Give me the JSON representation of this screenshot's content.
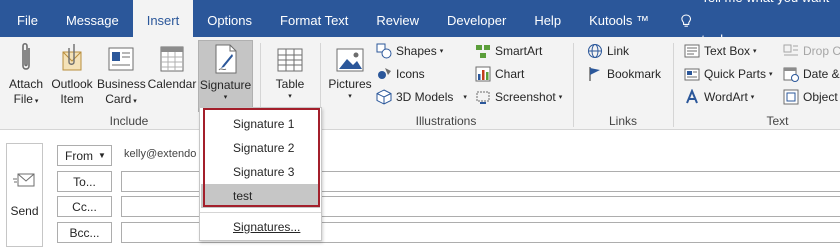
{
  "tabs": [
    {
      "label": "File",
      "active": false
    },
    {
      "label": "Message",
      "active": false
    },
    {
      "label": "Insert",
      "active": true
    },
    {
      "label": "Options",
      "active": false
    },
    {
      "label": "Format Text",
      "active": false
    },
    {
      "label": "Review",
      "active": false
    },
    {
      "label": "Developer",
      "active": false
    },
    {
      "label": "Help",
      "active": false
    },
    {
      "label": "Kutools ™",
      "active": false
    }
  ],
  "tell_me": "Tell me what you want to do",
  "ribbon": {
    "include": {
      "label": "Include",
      "attach_file": [
        "Attach",
        "File"
      ],
      "outlook_item": [
        "Outlook",
        "Item"
      ],
      "business_card": [
        "Business",
        "Card"
      ],
      "calendar": "Calendar",
      "signature": "Signature"
    },
    "tables": {
      "table": "Table"
    },
    "illustrations": {
      "label": "Illustrations",
      "pictures": "Pictures",
      "shapes": "Shapes",
      "icons": "Icons",
      "models_3d": "3D Models",
      "smartart": "SmartArt",
      "chart": "Chart",
      "screenshot": "Screenshot"
    },
    "links": {
      "label": "Links",
      "link": "Link",
      "bookmark": "Bookmark"
    },
    "text": {
      "label": "Text",
      "text_box": "Text Box",
      "quick_parts": "Quick Parts",
      "wordart": "WordArt",
      "drop_cap": "Drop Ca",
      "date_time": "Date &",
      "object": "Object"
    }
  },
  "compose": {
    "send": "Send",
    "from": "From",
    "from_value": "kelly@extendo",
    "to": "To...",
    "cc": "Cc...",
    "bcc": "Bcc..."
  },
  "signature_menu": {
    "items": [
      "Signature 1",
      "Signature 2",
      "Signature 3",
      "test"
    ],
    "highlighted": "test",
    "manage": "Signatures..."
  },
  "colors": {
    "tab_bar": "#2b579a",
    "ribbon_bg": "#f3f3f3",
    "highlight_outline": "#a31f2b",
    "hover_item": "#c6c6c6"
  }
}
